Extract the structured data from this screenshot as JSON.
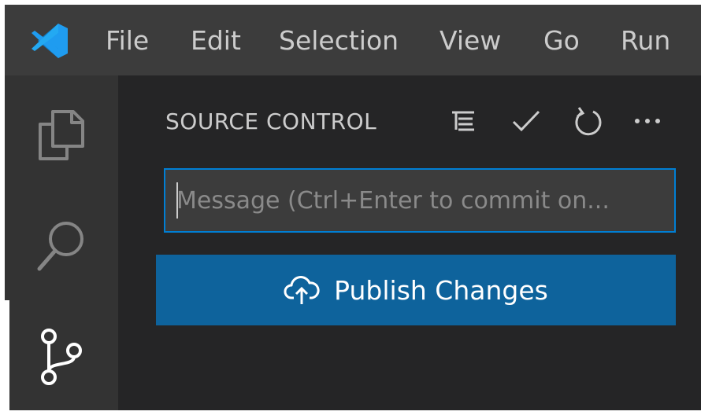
{
  "titlebar": {
    "logo_icon": "vscode-logo-icon",
    "menu": [
      {
        "label": "File"
      },
      {
        "label": "Edit"
      },
      {
        "label": "Selection"
      },
      {
        "label": "View"
      },
      {
        "label": "Go"
      },
      {
        "label": "Run"
      }
    ]
  },
  "activitybar": {
    "items": [
      {
        "icon": "explorer-files-icon"
      },
      {
        "icon": "search-icon"
      },
      {
        "icon": "source-control-icon"
      }
    ]
  },
  "source_control": {
    "title": "SOURCE CONTROL",
    "actions": [
      {
        "icon": "view-as-tree-icon"
      },
      {
        "icon": "commit-check-icon"
      },
      {
        "icon": "refresh-icon"
      },
      {
        "icon": "more-actions-icon"
      }
    ],
    "commit_input": {
      "value": "",
      "placeholder": "Message (Ctrl+Enter to commit on..."
    },
    "publish_button": {
      "label": "Publish Changes",
      "icon": "cloud-upload-icon"
    }
  },
  "colors": {
    "titlebar_bg": "#3c3c3c",
    "activitybar_bg": "#333333",
    "sidebar_bg": "#252526",
    "input_bg": "#3c3c3c",
    "focus_border": "#007fd4",
    "button_bg": "#0e639c",
    "text": "#cccccc",
    "logo_blue": "#23a9f2"
  }
}
